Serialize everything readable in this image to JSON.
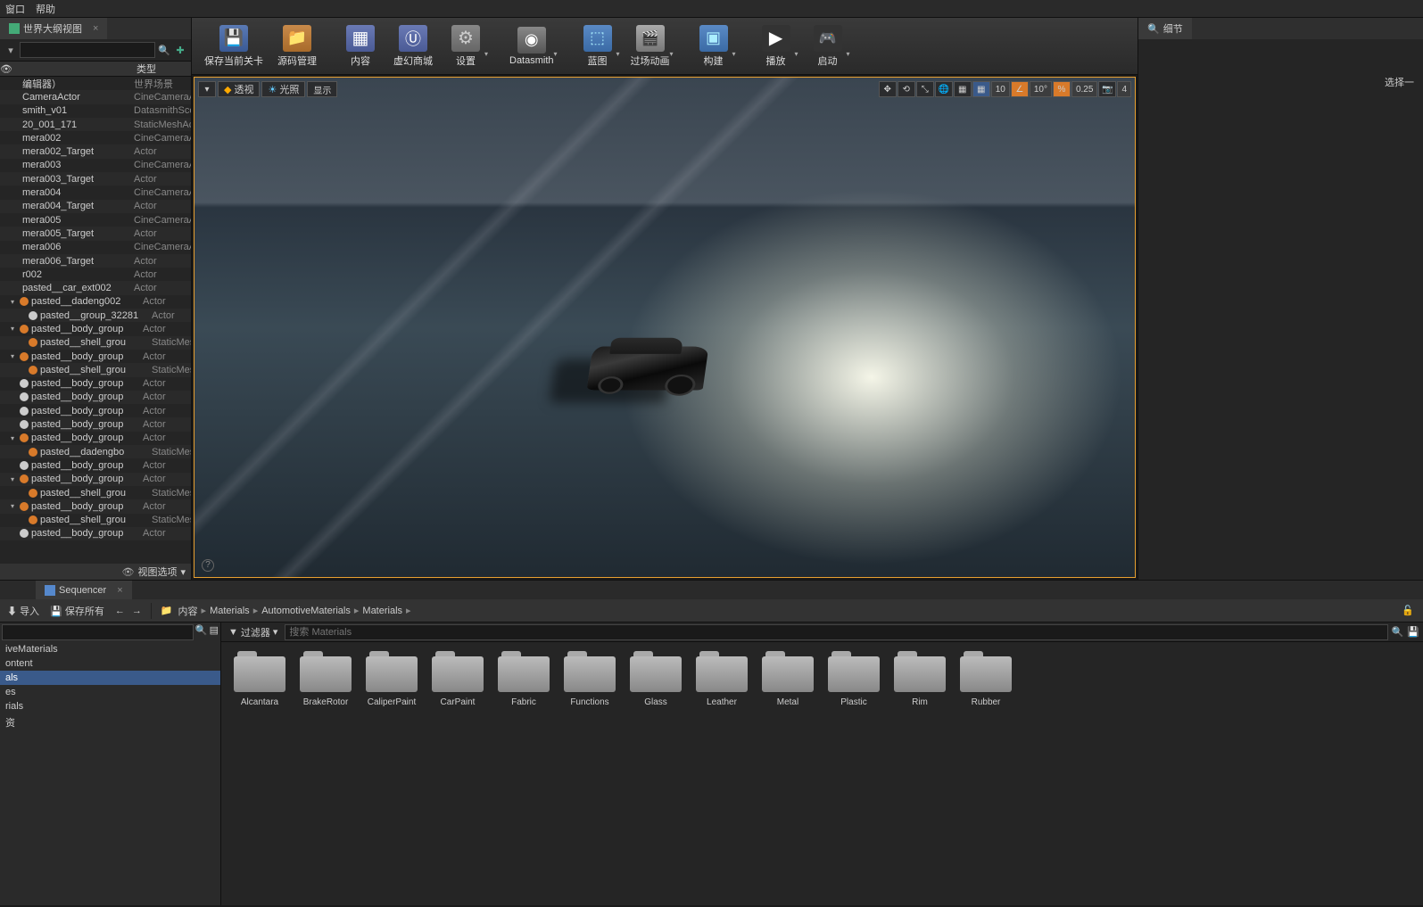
{
  "menu": {
    "window": "窗口",
    "help": "帮助"
  },
  "outliner": {
    "tab": "世界大纲视图",
    "search_placeholder": "",
    "col_type": "类型",
    "rows": [
      {
        "ind": 0,
        "arrow": "",
        "dot": "",
        "label": "编辑器）",
        "type": "世界场景"
      },
      {
        "ind": 0,
        "arrow": "",
        "dot": "",
        "label": "CameraActor",
        "type": "CineCameraActo"
      },
      {
        "ind": 0,
        "arrow": "",
        "dot": "",
        "label": "smith_v01",
        "type": "DatasmithScene"
      },
      {
        "ind": 0,
        "arrow": "",
        "dot": "",
        "label": "20_001_171",
        "type": "StaticMeshActo"
      },
      {
        "ind": 0,
        "arrow": "",
        "dot": "",
        "label": "mera002",
        "type": "CineCameraActo"
      },
      {
        "ind": 0,
        "arrow": "",
        "dot": "",
        "label": "mera002_Target",
        "type": "Actor"
      },
      {
        "ind": 0,
        "arrow": "",
        "dot": "",
        "label": "mera003",
        "type": "CineCameraActo"
      },
      {
        "ind": 0,
        "arrow": "",
        "dot": "",
        "label": "mera003_Target",
        "type": "Actor"
      },
      {
        "ind": 0,
        "arrow": "",
        "dot": "",
        "label": "mera004",
        "type": "CineCameraActo"
      },
      {
        "ind": 0,
        "arrow": "",
        "dot": "",
        "label": "mera004_Target",
        "type": "Actor"
      },
      {
        "ind": 0,
        "arrow": "",
        "dot": "",
        "label": "mera005",
        "type": "CineCameraActo"
      },
      {
        "ind": 0,
        "arrow": "",
        "dot": "",
        "label": "mera005_Target",
        "type": "Actor"
      },
      {
        "ind": 0,
        "arrow": "",
        "dot": "",
        "label": "mera006",
        "type": "CineCameraActo"
      },
      {
        "ind": 0,
        "arrow": "",
        "dot": "",
        "label": "mera006_Target",
        "type": "Actor"
      },
      {
        "ind": 0,
        "arrow": "",
        "dot": "",
        "label": "r002",
        "type": "Actor"
      },
      {
        "ind": 0,
        "arrow": "",
        "dot": "",
        "label": "pasted__car_ext002",
        "type": "Actor"
      },
      {
        "ind": 1,
        "arrow": "▾",
        "dot": "o",
        "label": "pasted__dadeng002",
        "type": "Actor"
      },
      {
        "ind": 2,
        "arrow": "",
        "dot": "w",
        "label": "pasted__group_32281",
        "type": "Actor"
      },
      {
        "ind": 1,
        "arrow": "▾",
        "dot": "o",
        "label": "pasted__body_group",
        "type": "Actor"
      },
      {
        "ind": 2,
        "arrow": "",
        "dot": "o",
        "label": "pasted__shell_grou",
        "type": "StaticMeshActo"
      },
      {
        "ind": 1,
        "arrow": "▾",
        "dot": "o",
        "label": "pasted__body_group",
        "type": "Actor"
      },
      {
        "ind": 2,
        "arrow": "",
        "dot": "o",
        "label": "pasted__shell_grou",
        "type": "StaticMeshActo"
      },
      {
        "ind": 1,
        "arrow": "",
        "dot": "w",
        "label": "pasted__body_group",
        "type": "Actor"
      },
      {
        "ind": 1,
        "arrow": "",
        "dot": "w",
        "label": "pasted__body_group",
        "type": "Actor"
      },
      {
        "ind": 1,
        "arrow": "",
        "dot": "w",
        "label": "pasted__body_group",
        "type": "Actor"
      },
      {
        "ind": 1,
        "arrow": "",
        "dot": "w",
        "label": "pasted__body_group",
        "type": "Actor"
      },
      {
        "ind": 1,
        "arrow": "▾",
        "dot": "o",
        "label": "pasted__body_group",
        "type": "Actor"
      },
      {
        "ind": 2,
        "arrow": "",
        "dot": "o",
        "label": "pasted__dadengbo",
        "type": "StaticMeshActo"
      },
      {
        "ind": 1,
        "arrow": "",
        "dot": "w",
        "label": "pasted__body_group",
        "type": "Actor"
      },
      {
        "ind": 1,
        "arrow": "▾",
        "dot": "o",
        "label": "pasted__body_group",
        "type": "Actor"
      },
      {
        "ind": 2,
        "arrow": "",
        "dot": "o",
        "label": "pasted__shell_grou",
        "type": "StaticMeshActo"
      },
      {
        "ind": 1,
        "arrow": "▾",
        "dot": "o",
        "label": "pasted__body_group",
        "type": "Actor"
      },
      {
        "ind": 2,
        "arrow": "",
        "dot": "o",
        "label": "pasted__shell_grou",
        "type": "StaticMeshActo"
      },
      {
        "ind": 1,
        "arrow": "",
        "dot": "w",
        "label": "pasted__body_group",
        "type": "Actor"
      }
    ],
    "view_options": "视图选项"
  },
  "toolbar": {
    "save": "保存当前关卡",
    "source": "源码管理",
    "content": "内容",
    "marketplace": "虚幻商城",
    "settings": "设置",
    "datasmith": "Datasmith",
    "blueprint": "蓝图",
    "cinematics": "过场动画",
    "build": "构建",
    "play": "播放",
    "launch": "启动"
  },
  "viewport": {
    "dd": "▾",
    "perspective": "透视",
    "lit": "光照",
    "show": "显示",
    "snap_pos": "10",
    "snap_rot": "10°",
    "snap_scl": "0.25",
    "cam_speed": "4"
  },
  "details": {
    "tab": "细节",
    "select_hint": "选择一"
  },
  "sequencer_tab": "Sequencer",
  "cb_toolbar": {
    "import": "导入",
    "save_all": "保存所有",
    "content": "内容",
    "crumb2": "Materials",
    "crumb3": "AutomotiveMaterials",
    "crumb4": "Materials"
  },
  "cb_filter": "过滤器",
  "cb_search_placeholder": "搜索 Materials",
  "src_tree": [
    "iveMaterials",
    "ontent",
    "als",
    "es",
    "rials",
    "资"
  ],
  "src_sel_index": 2,
  "assets": [
    "Alcantara",
    "BrakeRotor",
    "CaliperPaint",
    "CarPaint",
    "Fabric",
    "Functions",
    "Glass",
    "Leather",
    "Metal",
    "Plastic",
    "Rim",
    "Rubber"
  ]
}
